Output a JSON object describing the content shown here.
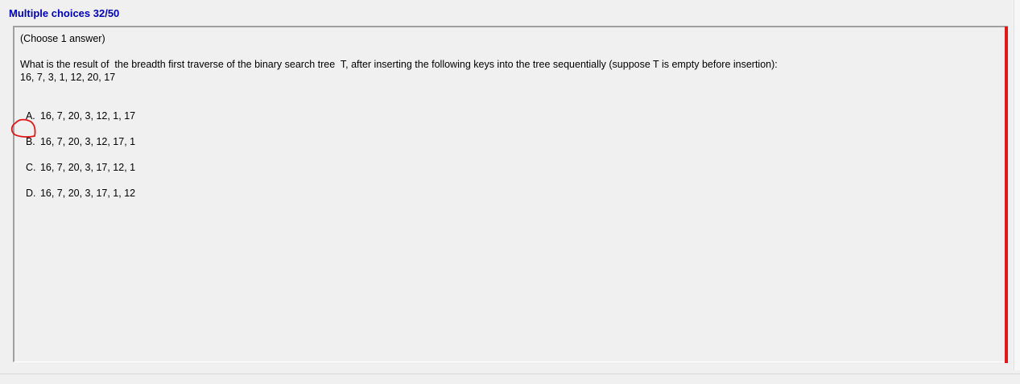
{
  "header": {
    "title": "Multiple choices 32/50"
  },
  "question": {
    "instruction": "(Choose 1 answer)",
    "text_line1": "What is the result of  the breadth first traverse of the binary search tree  T, after inserting the following keys into the tree sequentially (suppose T is empty before insertion):",
    "text_line2": "16, 7, 3, 1, 12, 20, 17"
  },
  "choices": [
    {
      "letter": "A.",
      "text": "16, 7, 20, 3, 12, 1, 17"
    },
    {
      "letter": "B.",
      "text": "16, 7, 20, 3, 12, 17, 1"
    },
    {
      "letter": "C.",
      "text": "16, 7, 20, 3, 17, 12, 1"
    },
    {
      "letter": "D.",
      "text": "16, 7, 20, 3, 17, 1, 12"
    }
  ],
  "selected_choice": "B.",
  "colors": {
    "title": "#0000b4",
    "accent_bar": "#e01818",
    "selection_mark": "#e01818",
    "background": "#f0f0f0"
  }
}
